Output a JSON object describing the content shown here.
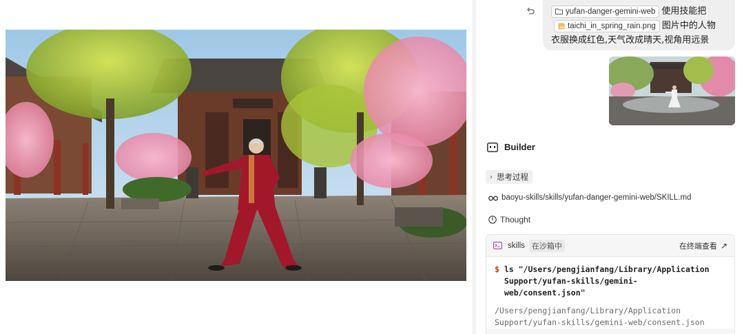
{
  "preview": {
    "image_name": "taichi_in_spring_rain.png"
  },
  "chat": {
    "undo_icon": "undo-icon",
    "user_message": {
      "skill_chip": "yufan-danger-gemini-web",
      "text_1": "使用技能把",
      "file_chip": "taichi_in_spring_rain.png",
      "text_2": "图片中的人物",
      "text_3": "衣服换成红色,天气改成晴天,视角用远景"
    },
    "assistant": {
      "name": "Builder",
      "thinking_label": "思考过程",
      "skill_file": "baoyu-skills/skills/yufan-danger-gemini-web/SKILL.md",
      "thought_label": "Thought"
    },
    "terminal": {
      "name": "skills",
      "status": "在沙箱中",
      "view_label": "在终端查看",
      "command_prompt": "$",
      "command_line_1": " ls \"/Users/pengjianfang/Library/Application",
      "command_line_2": "  Support/yufan-skills/gemini-",
      "command_line_3": "  web/consent.json\"",
      "output_line_1": "/Users/pengjianfang/Library/Application",
      "output_line_2": "Support/yufan-skills/gemini-web/consent.json"
    }
  },
  "colors": {
    "bubble_bg": "#efefef",
    "prompt_orange": "#c2410c",
    "robe_red": "#a3172a",
    "blossom_pink": "#ef9bb8",
    "willow_green": "#a8c438"
  }
}
